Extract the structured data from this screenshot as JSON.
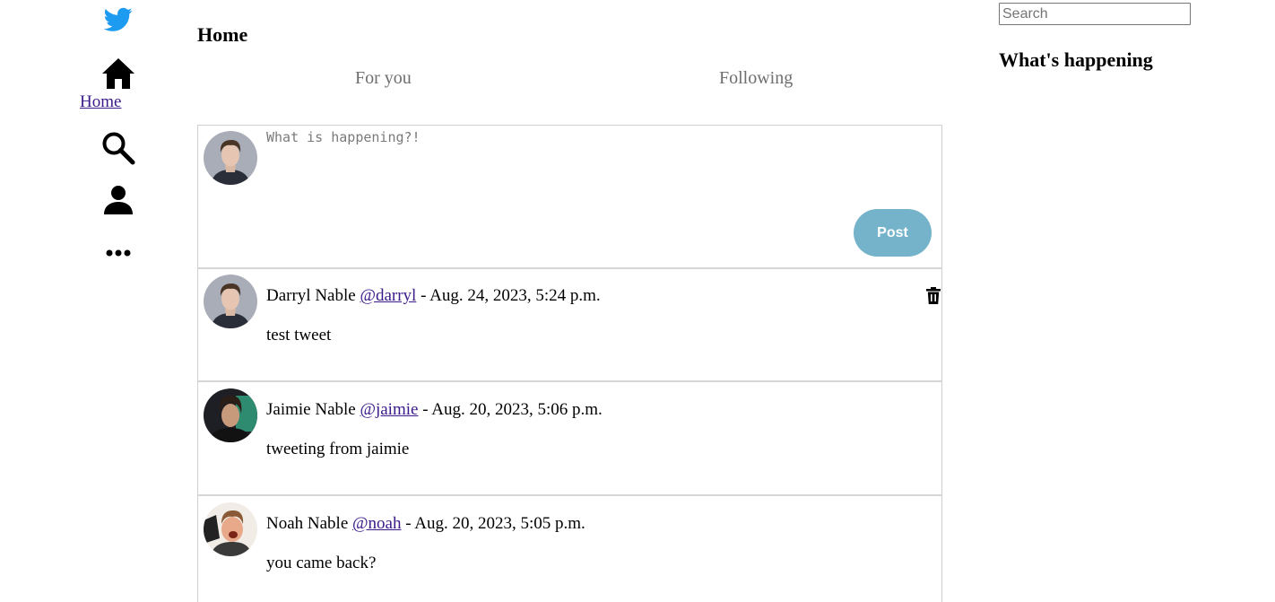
{
  "sidebar": {
    "logo_icon": "twitter-bird-icon",
    "brand_color": "#1d9bf0",
    "items": [
      {
        "icon": "home-icon",
        "label": "Home"
      },
      {
        "icon": "search-icon"
      },
      {
        "icon": "profile-icon"
      },
      {
        "icon": "more-icon"
      }
    ]
  },
  "header": {
    "title": "Home",
    "tabs": [
      {
        "label": "For you"
      },
      {
        "label": "Following"
      }
    ]
  },
  "composer": {
    "placeholder": "What is happening?!",
    "post_label": "Post",
    "post_color": "#74b3c9"
  },
  "tweets": [
    {
      "name": "Darryl Nable",
      "handle": "@darryl",
      "separator": " - ",
      "date": "Aug. 24, 2023, 5:24 p.m.",
      "text": "test tweet",
      "can_delete": true
    },
    {
      "name": "Jaimie Nable",
      "handle": "@jaimie",
      "separator": " - ",
      "date": "Aug. 20, 2023, 5:06 p.m.",
      "text": "tweeting from jaimie",
      "can_delete": false
    },
    {
      "name": "Noah Nable",
      "handle": "@noah",
      "separator": " - ",
      "date": "Aug. 20, 2023, 5:05 p.m.",
      "text": "you came back?",
      "can_delete": false
    }
  ],
  "right_sidebar": {
    "search_placeholder": "Search",
    "heading": "What's happening"
  },
  "link_color": "#3a1a8a"
}
